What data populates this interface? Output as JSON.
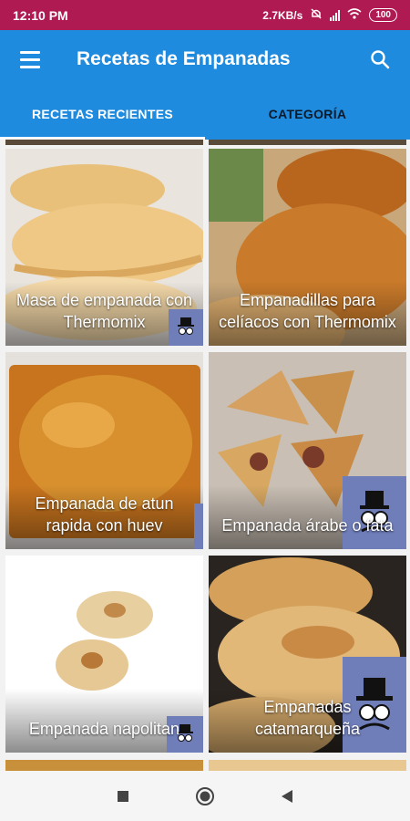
{
  "status_bar": {
    "time": "12:10 PM",
    "network_speed": "2.7KB/s",
    "battery": "100",
    "icons": [
      "mute-icon",
      "signal-icon",
      "wifi-icon",
      "battery-icon"
    ]
  },
  "app_bar": {
    "title": "Recetas de Empanadas",
    "menu_icon": "hamburger-menu-icon",
    "search_icon": "search-icon"
  },
  "tabs": [
    {
      "label": "RECETAS RECIENTES",
      "active": true
    },
    {
      "label": "CATEGORÍA",
      "active": false
    }
  ],
  "recipes": [
    {
      "title": "Masa de empanada con Thermomix",
      "has_badge": true
    },
    {
      "title": "Empanadillas para celíacos con Thermomix",
      "has_badge": false
    },
    {
      "title": "Empanada de atun rapida con huev",
      "has_badge": true
    },
    {
      "title": "Empanada árabe o fata",
      "has_badge": true
    },
    {
      "title": "Empanada napolitan",
      "has_badge": true
    },
    {
      "title": "Empanadas catamarqueña",
      "has_badge": true
    }
  ],
  "nav_bar": {
    "buttons": [
      "recents-square-icon",
      "home-circle-icon",
      "back-triangle-icon"
    ]
  },
  "colors": {
    "status_bar": "#b01a52",
    "app_bar": "#1f8bde",
    "badge": "#6f7db8"
  }
}
